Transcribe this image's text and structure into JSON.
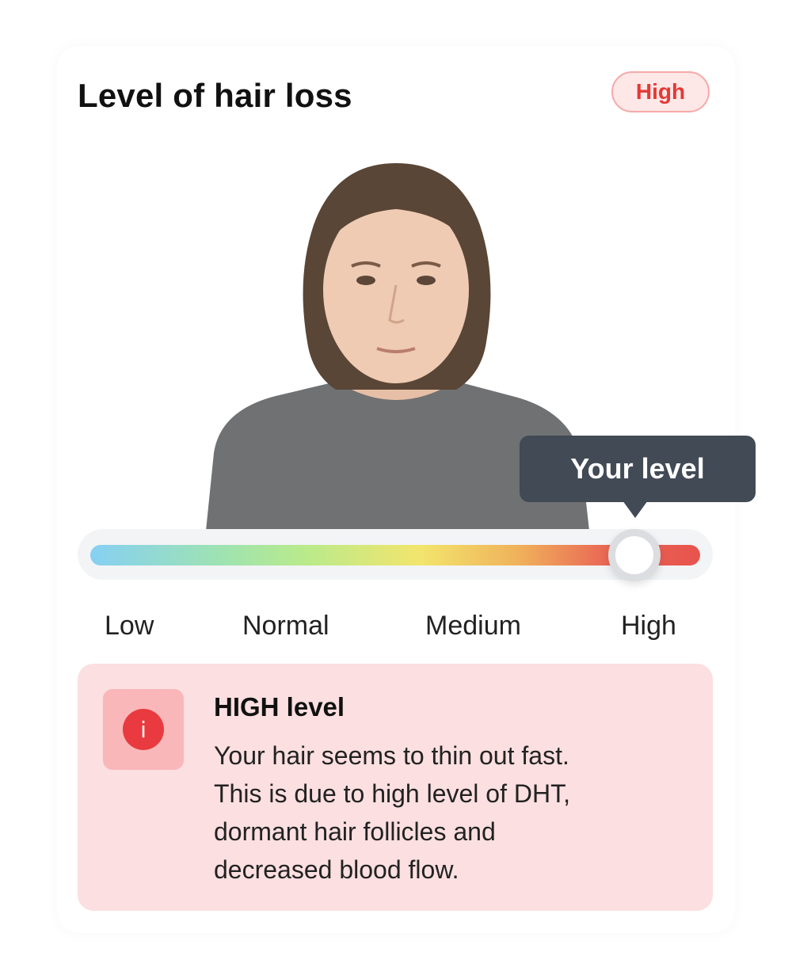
{
  "header": {
    "title": "Level of hair loss",
    "badge": "High"
  },
  "portrait": {
    "icon": "person-portrait-image"
  },
  "slider": {
    "tooltip": "Your level",
    "value_label": "High",
    "value_fraction": 0.89,
    "labels": [
      "Low",
      "Normal",
      "Medium",
      "High"
    ],
    "gradient_colors": [
      "#86d0f3",
      "#9fe3b0",
      "#b9ea8c",
      "#f2e56d",
      "#f0b25b",
      "#ea6a55",
      "#e8534d"
    ]
  },
  "info": {
    "icon": "info-icon",
    "icon_glyph": "i",
    "title": "HIGH level",
    "lines": [
      "Your hair seems to thin out fast.",
      "This is due to high level of DHT,",
      "dormant hair follicles and",
      "decreased blood flow."
    ]
  },
  "colors": {
    "accent_red": "#e53935",
    "tooltip_bg": "#414a55",
    "info_bg": "#fcdfe0"
  }
}
